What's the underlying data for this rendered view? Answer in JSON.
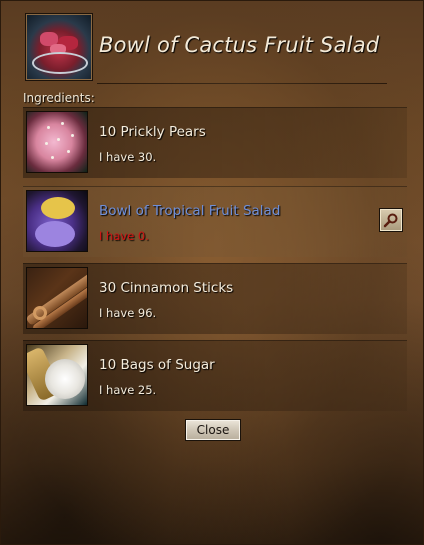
{
  "window": {
    "title": "Bowl of Cactus Fruit Salad",
    "title_icon": "cactus-fruit-salad-bowl-icon"
  },
  "ingredients": {
    "label": "Ingredients:",
    "items": [
      {
        "name": "10 Prickly Pears",
        "have": "I have 30.",
        "icon": "prickly-pear-icon",
        "sufficient": true
      },
      {
        "name": "Bowl of Tropical Fruit Salad",
        "have": "I have 0.",
        "icon": "tropical-fruit-salad-icon",
        "sufficient": false,
        "linked": true
      },
      {
        "name": "30 Cinnamon Sticks",
        "have": "I have 96.",
        "icon": "cinnamon-sticks-icon",
        "sufficient": true
      },
      {
        "name": "10 Bags of Sugar",
        "have": "I have 25.",
        "icon": "sugar-bags-icon",
        "sufficient": true
      }
    ]
  },
  "buttons": {
    "close_label": "Close",
    "magnify_icon": "magnifier-icon"
  },
  "colors": {
    "link_text": "#6f8fd8",
    "missing_text": "#d21414",
    "normal_text": "#f4ecdc"
  }
}
